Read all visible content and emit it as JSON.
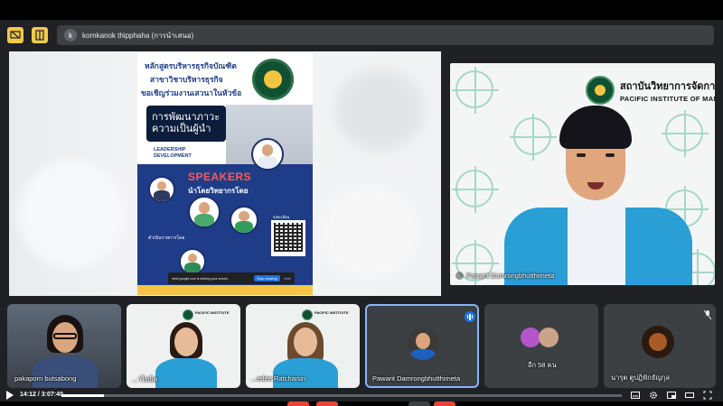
{
  "header": {
    "presenter_initial": "k",
    "presenter_label": "kornkanok thipphaha (การนำเสนอ)"
  },
  "shared_screen": {
    "poster": {
      "title_lines": [
        "หลักสูตรบริหารธุรกิจบัณฑิต",
        "สาขาวิชาบริหารธุรกิจ",
        "ขอเชิญร่วมงานเสวนาในหัวข้อ"
      ],
      "topic_lines": [
        "การพัฒนาภาวะ",
        "ความเป็นผู้นำ"
      ],
      "topic_en_lines": [
        "LEADERSHIP",
        "DEVELOPMENT"
      ],
      "speakers_label": "SPEAKERS",
      "speakers_th": "นำโดยวิทยากรโดย",
      "moderator_label": "ดำเนินรายการโดย",
      "register_label": "ลงทะเบียน"
    },
    "share_notice": {
      "text": "meet.google.com is sharing your screen.",
      "stop_label": "Stop sharing",
      "hide_label": "Hide"
    }
  },
  "main_speaker": {
    "institution_th": "สถาบันวิทยาการจัดกา",
    "institution_en": "PACIFIC INSTITUTE OF MANA",
    "name": "Pawarit Damrongbhutthimeta"
  },
  "participants": [
    {
      "name": "pakaporn butsabong"
    },
    {
      "name": "...าไทยิต"
    },
    {
      "name": "...edee Ratchaisin"
    },
    {
      "name": "Pawarit Damrongbhutthimeta"
    },
    {
      "name": "อีก 58 คน"
    },
    {
      "name": "นารุต ตูปฎิฟักธัญกุล"
    }
  ],
  "player": {
    "time": "14:12 / 3:07:40",
    "progress": 0.076
  },
  "colors": {
    "accent_yellow": "#f2c94c",
    "active_border": "#8ab4f8",
    "meet_blue": "#1a73e8",
    "poster_blue": "#1f3c88",
    "speakers_red": "#ff5a4e"
  }
}
